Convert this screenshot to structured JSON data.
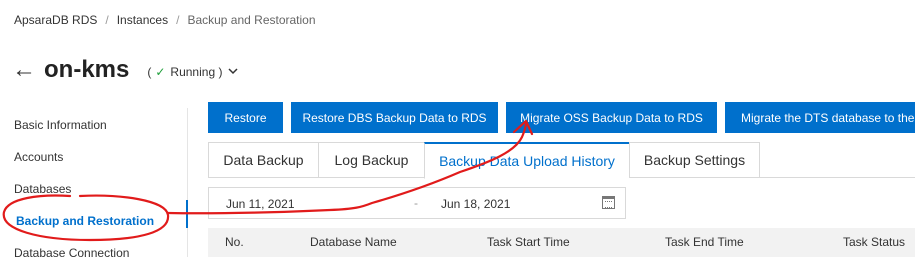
{
  "breadcrumb": [
    "ApsaraDB RDS",
    "Instances",
    "Backup and Restoration"
  ],
  "instance": {
    "name": "on-kms",
    "status": "Running"
  },
  "sidebar": {
    "items": [
      "Basic Information",
      "Accounts",
      "Databases",
      "Backup and Restoration",
      "Database Connection"
    ]
  },
  "actions": [
    "Restore",
    "Restore DBS Backup Data to RDS",
    "Migrate OSS Backup Data to RDS",
    "Migrate the DTS database to the"
  ],
  "tabs": [
    "Data Backup",
    "Log Backup",
    "Backup Data Upload History",
    "Backup Settings"
  ],
  "date_range": {
    "start": "Jun 11, 2021",
    "separator": "-",
    "end": "Jun 18, 2021"
  },
  "table": {
    "columns": [
      "No.",
      "Database Name",
      "Task Start Time",
      "Task End Time",
      "Task Status"
    ]
  },
  "colors": {
    "primary": "#0070cc",
    "annotation": "#e11b1b",
    "running": "#1e9f3a"
  },
  "icons": {
    "back": "arrow-left-icon",
    "status": "check-icon",
    "dropdown": "chevron-down-icon",
    "calendar": "calendar-icon"
  }
}
